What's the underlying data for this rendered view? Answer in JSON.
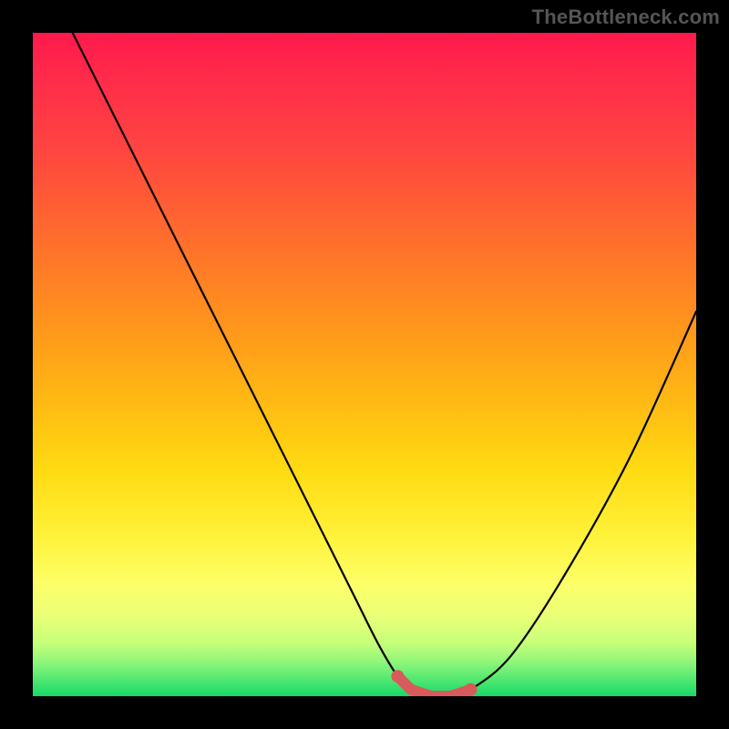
{
  "watermark": "TheBottleneck.com",
  "chart_data": {
    "type": "line",
    "title": "",
    "xlabel": "",
    "ylabel": "",
    "xlim": [
      0,
      100
    ],
    "ylim": [
      0,
      100
    ],
    "grid": false,
    "series": [
      {
        "name": "bottleneck-curve",
        "x": [
          6,
          12,
          20,
          30,
          40,
          48,
          52,
          55,
          57,
          60,
          63,
          66,
          72,
          80,
          90,
          100
        ],
        "values": [
          100,
          88,
          72,
          52,
          32,
          16,
          8,
          3,
          1,
          0,
          0,
          1,
          6,
          18,
          36,
          58
        ]
      }
    ],
    "highlight_region": {
      "name": "optimal-flat-bottom",
      "x": [
        55,
        57,
        60,
        63,
        66
      ],
      "values": [
        3,
        1,
        0,
        0,
        1
      ],
      "color": "#d85a5a"
    },
    "background_gradient": {
      "stops": [
        {
          "pos": 0,
          "color": "#ff1a4d"
        },
        {
          "pos": 30,
          "color": "#ff6a2e"
        },
        {
          "pos": 55,
          "color": "#ffb813"
        },
        {
          "pos": 76,
          "color": "#fff23a"
        },
        {
          "pos": 92,
          "color": "#c6ff79"
        },
        {
          "pos": 100,
          "color": "#16d96a"
        }
      ]
    }
  }
}
